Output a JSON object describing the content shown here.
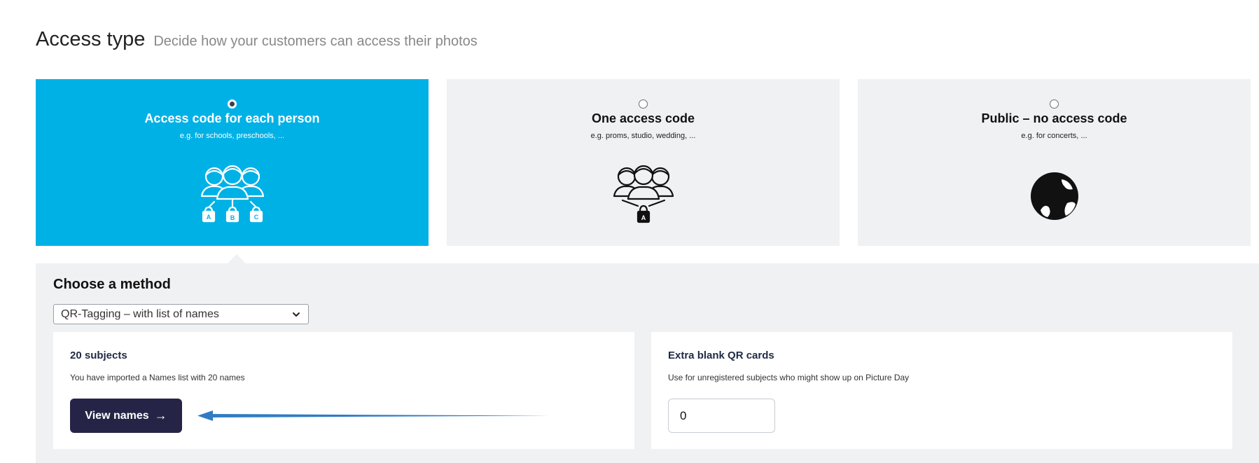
{
  "header": {
    "title": "Access type",
    "subtitle": "Decide how your customers can access their photos"
  },
  "access_options": [
    {
      "title": "Access code for each person",
      "description": "e.g. for schools, preschools, ...",
      "selected": true,
      "icon": "group-multiple-locks-icon",
      "lock_letters": [
        "A",
        "B",
        "C"
      ]
    },
    {
      "title": "One access code",
      "description": "e.g. proms, studio, wedding, ...",
      "selected": false,
      "icon": "group-single-lock-icon",
      "lock_letters": [
        "A"
      ]
    },
    {
      "title": "Public – no access code",
      "description": "e.g. for concerts, ...",
      "selected": false,
      "icon": "globe-icon"
    }
  ],
  "colors": {
    "selected_card": "#00b1e6",
    "card_bg": "#f0f1f3",
    "button_bg": "#262446",
    "annotation_arrow": "#2f7cc4"
  },
  "method": {
    "title": "Choose a method",
    "selected_value": "QR-Tagging – with list of names"
  },
  "subjects": {
    "title": "20 subjects",
    "description": "You have imported a Names list with 20 names",
    "button_label": "View names",
    "button_arrow": "→"
  },
  "extra_cards": {
    "title": "Extra blank QR cards",
    "description": "Use for unregistered subjects who might show up on Picture Day",
    "value": "0"
  }
}
